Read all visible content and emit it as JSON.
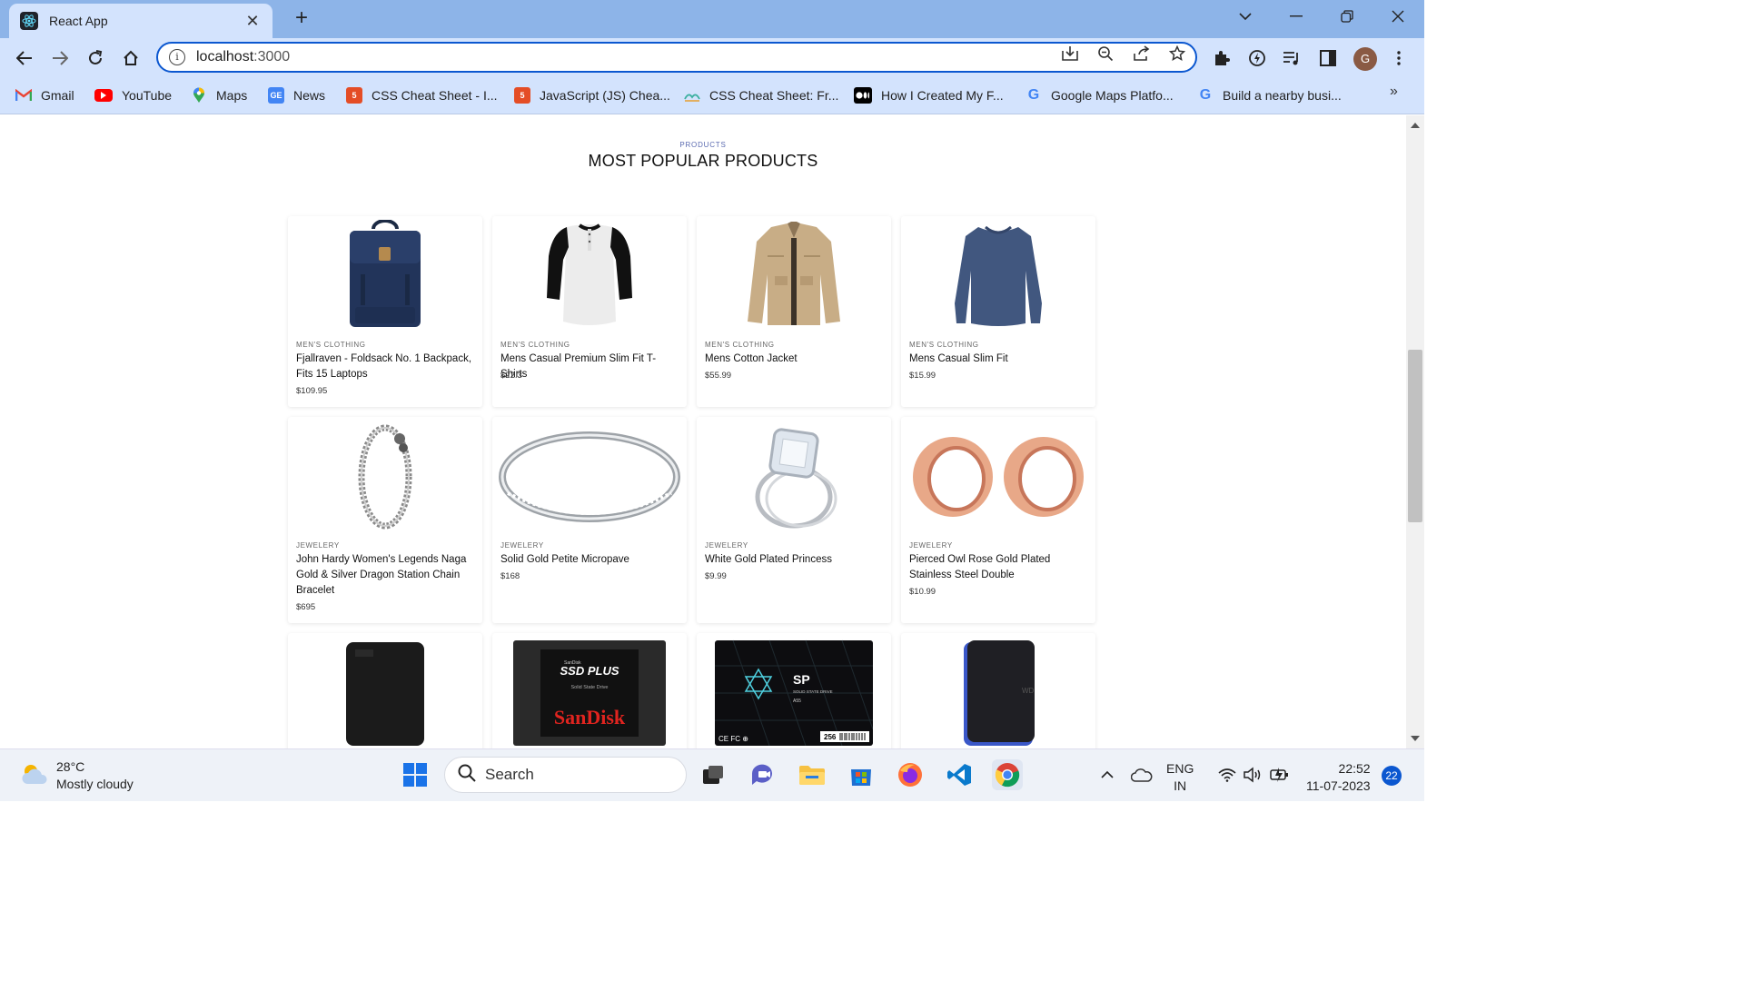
{
  "browser": {
    "tab_title": "React App",
    "url_host": "localhost",
    "url_port": ":3000",
    "profile_initial": "G",
    "bookmarks": [
      {
        "label": "Gmail",
        "icon": "gmail-icon"
      },
      {
        "label": "YouTube",
        "icon": "youtube-icon"
      },
      {
        "label": "Maps",
        "icon": "maps-icon"
      },
      {
        "label": "News",
        "icon": "news-icon"
      },
      {
        "label": "CSS Cheat Sheet - I...",
        "icon": "html5-icon"
      },
      {
        "label": "JavaScript (JS) Chea...",
        "icon": "html5-icon"
      },
      {
        "label": "CSS Cheat Sheet: Fr...",
        "icon": "wave-icon"
      },
      {
        "label": "How I Created My F...",
        "icon": "medium-icon"
      },
      {
        "label": "Google Maps Platfo...",
        "icon": "google-icon"
      },
      {
        "label": "Build a nearby busi...",
        "icon": "google-icon"
      }
    ]
  },
  "section": {
    "eyebrow": "PRODUCTS",
    "heading": "MOST POPULAR PRODUCTS"
  },
  "products": [
    {
      "category": "MEN'S CLOTHING",
      "name": "Fjallraven - Foldsack No. 1 Backpack, Fits 15 Laptops",
      "price": "$109.95",
      "image": "backpack"
    },
    {
      "category": "MEN'S CLOTHING",
      "name": "Mens Casual Premium Slim Fit T-Shirts",
      "price": "$22.3",
      "image": "raglan-tshirt"
    },
    {
      "category": "MEN'S CLOTHING",
      "name": "Mens Cotton Jacket",
      "price": "$55.99",
      "image": "cotton-jacket"
    },
    {
      "category": "MEN'S CLOTHING",
      "name": "Mens Casual Slim Fit",
      "price": "$15.99",
      "image": "long-sleeve-shirt"
    },
    {
      "category": "JEWELERY",
      "name": "John Hardy Women's Legends Naga Gold & Silver Dragon Station Chain Bracelet",
      "price": "$695",
      "image": "dragon-bracelet"
    },
    {
      "category": "JEWELERY",
      "name": "Solid Gold Petite Micropave",
      "price": "$168",
      "image": "pave-ring"
    },
    {
      "category": "JEWELERY",
      "name": "White Gold Plated Princess",
      "price": "$9.99",
      "image": "princess-ring"
    },
    {
      "category": "JEWELERY",
      "name": "Pierced Owl Rose Gold Plated Stainless Steel Double",
      "price": "$10.99",
      "image": "rose-gold-plugs"
    },
    {
      "category": "",
      "name": "",
      "price": "",
      "image": "external-hard-drive"
    },
    {
      "category": "",
      "name": "",
      "price": "",
      "image": "sandisk-ssd"
    },
    {
      "category": "",
      "name": "",
      "price": "",
      "image": "sp-ssd"
    },
    {
      "category": "",
      "name": "",
      "price": "",
      "image": "wd-gaming-drive"
    }
  ],
  "product_images": {
    "sandisk_small": "SanDisk",
    "sandisk_line": "SSD PLUS",
    "sandisk_sub": "Solid State Drive",
    "sandisk_brand": "SanDisk",
    "sp_logo": "SP",
    "sp_sub": "SOLID STATE DRIVE",
    "sp_model": "A55",
    "sp_capacity": "256",
    "sp_cert": "CE FC ⊕",
    "wd_logo": "WD"
  },
  "taskbar": {
    "temperature": "28°C",
    "weather": "Mostly cloudy",
    "search_placeholder": "Search",
    "lang_1": "ENG",
    "lang_2": "IN",
    "time": "22:52",
    "date": "11-07-2023",
    "notifications": "22"
  },
  "colors": {
    "tabstrip": "#8db4e8",
    "toolbar": "#d3e3fd",
    "accent": "#0b57d0",
    "eyebrow": "#5a6ab0"
  }
}
